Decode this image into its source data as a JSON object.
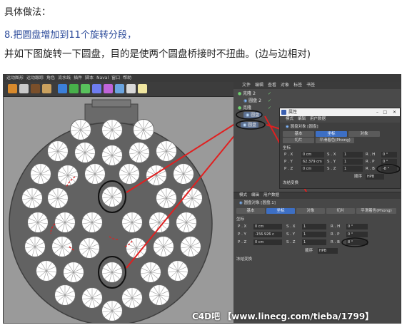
{
  "article": {
    "heading": "具体做法：",
    "step": "8.把圆盘增加到11个旋转分段，",
    "desc": "并如下图旋转一下圆盘，目的是使两个圆盘桥接时不扭曲。(边与边相对)"
  },
  "app": {
    "menu": [
      "运动图形",
      "运动跟踪",
      "角色",
      "流水线",
      "插件",
      "脚本",
      "Naval",
      "窗口",
      "帮助"
    ],
    "tools_colors": [
      "#d98a2c",
      "#c9c9c9",
      "#7a4f2a",
      "#caa15e",
      "#3b7fd9",
      "#47b04a",
      "#58c25c",
      "#6e7cf0",
      "#c064d9",
      "#6aa4e0",
      "#d8d8d8",
      "#f0e6a0"
    ]
  },
  "object_manager": {
    "tabs": [
      "文件",
      "编辑",
      "查看",
      "对象",
      "标签",
      "书签"
    ],
    "rows": [
      {
        "label": "克隆 2"
      },
      {
        "label": "圆盘 2"
      },
      {
        "label": "克隆"
      },
      {
        "label": "圆盘"
      },
      {
        "label": "圆盘"
      }
    ]
  },
  "dialog": {
    "title": "属性",
    "menu": [
      "模式",
      "编辑",
      "用户数据"
    ],
    "object_line": "圆盘对象 [圆盘]",
    "tabs": [
      "基本",
      "坐标",
      "对象"
    ],
    "subtabs": [
      "切片",
      "平滑着色(Phong)"
    ],
    "section": "坐标",
    "rows": [
      {
        "p_label": "P . X",
        "p_val": "0 cm",
        "s_label": "S . X",
        "s_val": "1",
        "r_label": "R . H",
        "r_val": "0 °"
      },
      {
        "p_label": "P . Y",
        "p_val": "62.379 cm",
        "s_label": "S . Y",
        "s_val": "1",
        "r_label": "R . P",
        "r_val": "0 °"
      },
      {
        "p_label": "P . Z",
        "p_val": "0 cm",
        "s_label": "S . Z",
        "s_val": "1",
        "r_label": "R . B",
        "r_val": "-8 °"
      }
    ],
    "order_label": "顺序",
    "order_value": "HPB",
    "freeze": "冻结变换"
  },
  "attributes": {
    "menu": [
      "模式",
      "编辑",
      "用户数据"
    ],
    "object_line": "圆盘对象 [圆盘.1]",
    "tabs": [
      "基本",
      "坐标",
      "对象",
      "切片",
      "平滑着色(Phong)"
    ],
    "section": "坐标",
    "rows": [
      {
        "p_label": "P . X",
        "p_val": "0 cm",
        "s_label": "S . X",
        "s_val": "1",
        "r_label": "R . H",
        "r_val": "0 °"
      },
      {
        "p_label": "P . Y",
        "p_val": "-156.926 c",
        "s_label": "S . Y",
        "s_val": "1",
        "r_label": "R . P",
        "r_val": "0 °"
      },
      {
        "p_label": "P . Z",
        "p_val": "0 cm",
        "s_label": "S . Z",
        "s_val": "1",
        "r_label": "R . B",
        "r_val": "8 °"
      }
    ],
    "order_label": "顺序",
    "order_value": "HPB",
    "freeze": "冻结变换"
  },
  "watermark": "C4D吧 【www.linecg.com/tieba/1799】"
}
